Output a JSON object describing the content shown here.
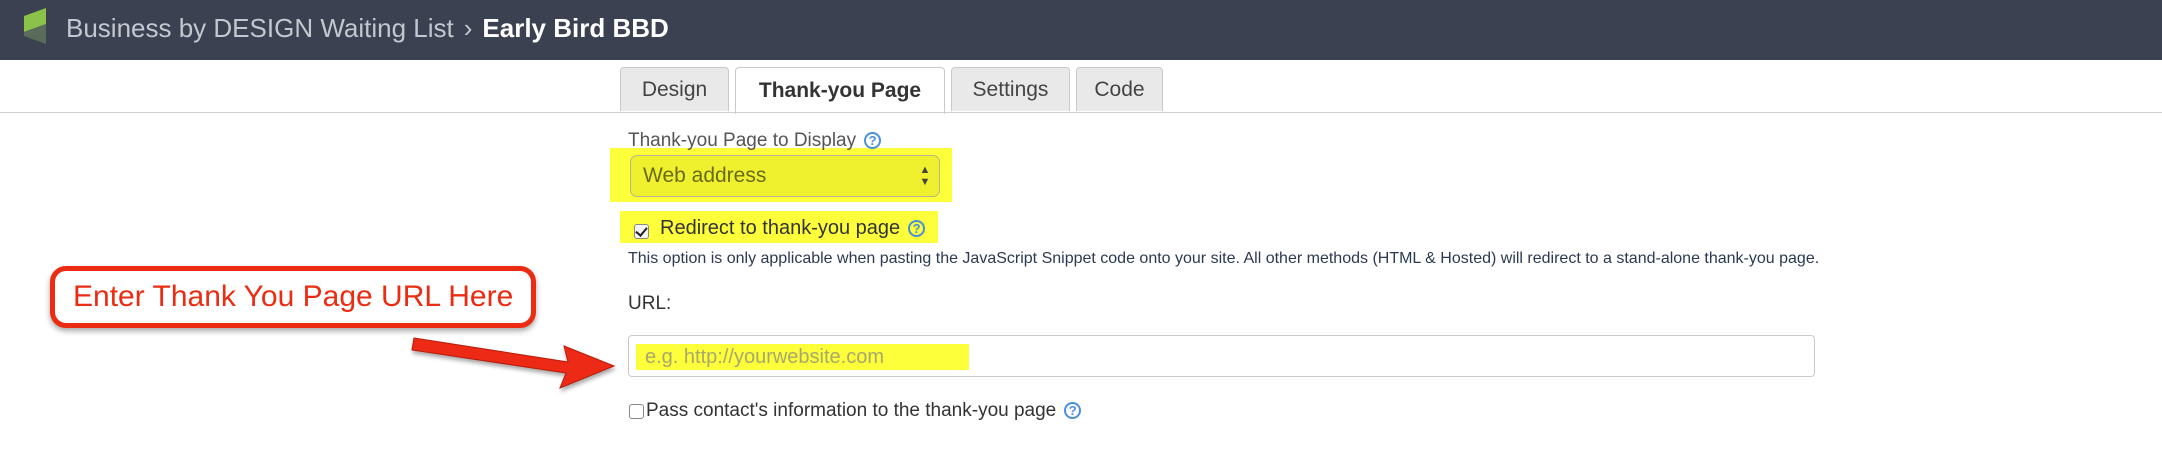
{
  "header": {
    "parent_title": "Business by DESIGN Waiting List",
    "separator": "›",
    "current_title": "Early Bird BBD"
  },
  "tabs": [
    {
      "label": "Design",
      "active": false
    },
    {
      "label": "Thank-you Page",
      "active": true
    },
    {
      "label": "Settings",
      "active": false
    },
    {
      "label": "Code",
      "active": false
    }
  ],
  "form": {
    "display_label": "Thank-you Page to Display",
    "display_select_value": "Web address",
    "redirect_label": "Redirect to thank-you page",
    "redirect_checked": true,
    "note": "This option is only applicable when pasting the JavaScript Snippet code onto your site. All other methods (HTML & Hosted) will redirect to a stand-alone thank-you page.",
    "url_label": "URL:",
    "url_placeholder": "e.g. http://yourwebsite.com",
    "pass_info_label": "Pass contact's information to the thank-you page",
    "pass_info_checked": false,
    "help_glyph": "?"
  },
  "annotation": {
    "callout_text": "Enter Thank You Page URL Here"
  },
  "colors": {
    "header_bg": "#3b4150",
    "highlight": "#fcff3a",
    "callout_red": "#ec2c12",
    "help_blue": "#4a90d9",
    "logo_green": "#7cb342"
  }
}
